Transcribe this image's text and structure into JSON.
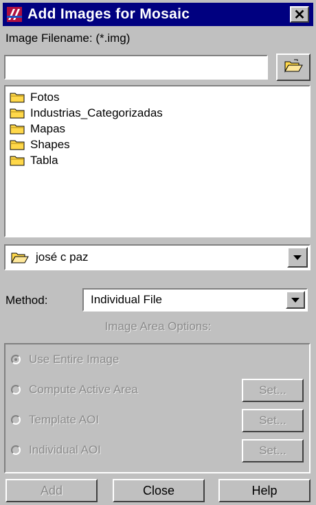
{
  "window": {
    "title": "Add Images for Mosaic",
    "close_label": "✕",
    "icon": "app-icon"
  },
  "filename": {
    "label": "Image Filename: (*.img)",
    "value": "",
    "placeholder": ""
  },
  "browse": {
    "icon": "open-folder-icon"
  },
  "file_list": {
    "items": [
      {
        "label": "Fotos",
        "icon": "folder-icon"
      },
      {
        "label": "Industrias_Categorizadas",
        "icon": "folder-icon"
      },
      {
        "label": "Mapas",
        "icon": "folder-icon"
      },
      {
        "label": "Shapes",
        "icon": "folder-icon"
      },
      {
        "label": "Tabla",
        "icon": "folder-icon"
      }
    ]
  },
  "directory": {
    "value": "josé c paz",
    "icon": "open-folder-icon"
  },
  "method": {
    "label": "Method:",
    "value": "Individual File"
  },
  "image_area": {
    "caption": "Image Area Options:",
    "options": [
      {
        "label": "Use Entire Image",
        "checked": true,
        "has_set": false
      },
      {
        "label": "Compute Active Area",
        "checked": false,
        "has_set": true
      },
      {
        "label": "Template AOI",
        "checked": false,
        "has_set": true
      },
      {
        "label": "Individual AOI",
        "checked": false,
        "has_set": true
      }
    ],
    "set_label": "Set..."
  },
  "buttons": {
    "add": "Add",
    "close": "Close",
    "help": "Help"
  },
  "colors": {
    "titlebar": "#000080",
    "face": "#c0c0c0",
    "disabled_text": "#8a8a8a",
    "folder": "#ffd84a"
  }
}
